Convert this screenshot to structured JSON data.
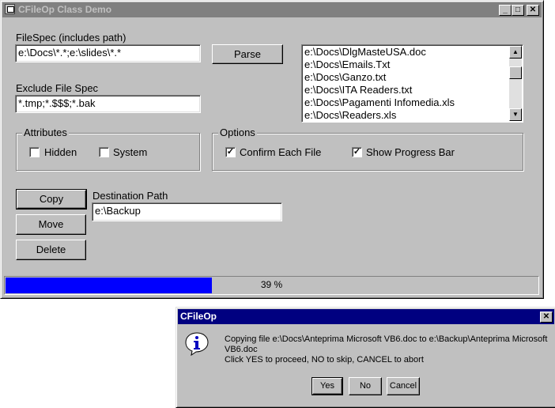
{
  "main_window": {
    "title": "CFileOp Class Demo",
    "buttons": {
      "minimize": "_",
      "maximize": "□",
      "close": "✕"
    }
  },
  "filespec": {
    "label": "FileSpec (includes path)",
    "value": "e:\\Docs\\*.*;e:\\slides\\*.*"
  },
  "parse_button": "Parse",
  "exclude": {
    "label": "Exclude File Spec",
    "value": "*.tmp;*.$$$;*.bak"
  },
  "file_list": {
    "items": [
      "e:\\Docs\\DlgMasteUSA.doc",
      "e:\\Docs\\Emails.Txt",
      "e:\\Docs\\Ganzo.txt",
      "e:\\Docs\\ITA Readers.txt",
      "e:\\Docs\\Pagamenti Infomedia.xls",
      "e:\\Docs\\Readers.xls"
    ],
    "scroll_up": "▲",
    "scroll_down": "▼"
  },
  "attributes": {
    "title": "Attributes",
    "hidden": {
      "label": "Hidden",
      "checked": false
    },
    "system": {
      "label": "System",
      "checked": false
    }
  },
  "options": {
    "title": "Options",
    "confirm": {
      "label": "Confirm Each File",
      "checked": true
    },
    "progress": {
      "label": "Show Progress Bar",
      "checked": true
    }
  },
  "actions": {
    "copy": "Copy",
    "move": "Move",
    "delete": "Delete"
  },
  "destination": {
    "label": "Destination Path",
    "value": "e:\\Backup"
  },
  "progress_bar": {
    "percent": 39,
    "text": "39 %",
    "fill_color": "#0000ff"
  },
  "dialog": {
    "title": "CFileOp",
    "close": "✕",
    "icon": "information-icon",
    "line1": "Copying file e:\\Docs\\Anteprima Microsoft VB6.doc to e:\\Backup\\Anteprima Microsoft",
    "line2": "VB6.doc",
    "line3": "Click YES to proceed, NO to skip, CANCEL to abort",
    "yes": "Yes",
    "no": "No",
    "cancel": "Cancel"
  },
  "colors": {
    "face": "#c0c0c0",
    "title_active": "#000080",
    "title_inactive": "#808080"
  }
}
